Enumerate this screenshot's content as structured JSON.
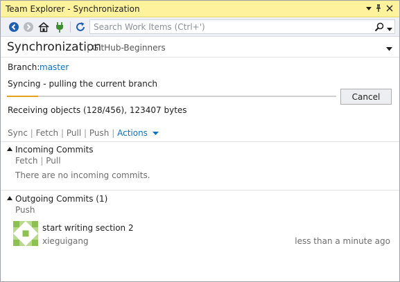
{
  "window": {
    "title": "Team Explorer - Synchronization"
  },
  "toolbar": {
    "search_placeholder": "Search Work Items (Ctrl+')"
  },
  "header": {
    "title": "Synchronization",
    "separator": "|",
    "repository": "GitHub-Beginners"
  },
  "branch": {
    "label": "Branch:",
    "name": "master"
  },
  "status": {
    "message": "Syncing - pulling the current branch",
    "progress_fraction": 0.095,
    "detail": "Receiving objects (128/456), 123407 bytes",
    "cancel_label": "Cancel"
  },
  "actions": {
    "sync": "Sync",
    "fetch": "Fetch",
    "pull": "Pull",
    "push": "Push",
    "actions_menu": "Actions",
    "sep": "|"
  },
  "incoming": {
    "title": "Incoming Commits",
    "fetch": "Fetch",
    "pull": "Pull",
    "sep": "|",
    "empty_message": "There are no incoming commits."
  },
  "outgoing": {
    "title": "Outgoing Commits (1)",
    "push": "Push",
    "commits": [
      {
        "message": "start writing section 2",
        "author": "xieguigang",
        "time": "less than a minute ago"
      }
    ]
  },
  "colors": {
    "accent_link": "#0e70c0",
    "titlebar": "#fff29d",
    "progress": "#e2a11f"
  }
}
